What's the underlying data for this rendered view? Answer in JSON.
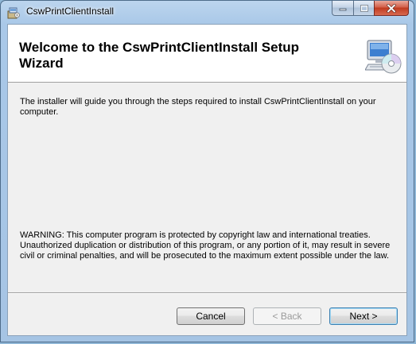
{
  "window": {
    "title": "CswPrintClientInstall"
  },
  "header": {
    "title": "Welcome to the CswPrintClientInstall Setup Wizard"
  },
  "body": {
    "intro": "The installer will guide you through the steps required to install CswPrintClientInstall on your computer.",
    "warning": "WARNING: This computer program is protected by copyright law and international treaties. Unauthorized duplication or distribution of this program, or any portion of it, may result in severe civil or criminal penalties, and will be prosecuted to the maximum extent possible under the law."
  },
  "buttons": {
    "cancel": "Cancel",
    "back": "< Back",
    "next": "Next >",
    "back_enabled": false
  },
  "icons": {
    "app": "installer-package-icon",
    "header": "computer-cd-icon",
    "minimize": "minimize-icon",
    "maximize": "maximize-icon",
    "close": "close-icon"
  },
  "colors": {
    "frame": "#a9c8e8",
    "close_button": "#c0391f",
    "default_button_border": "#3c7fb1"
  }
}
